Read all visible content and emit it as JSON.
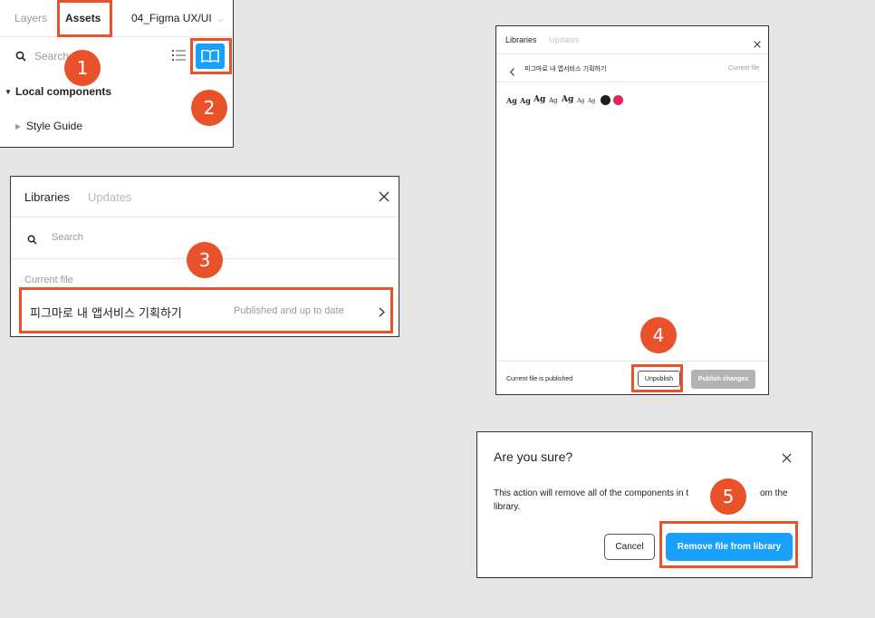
{
  "assets_panel": {
    "tab_layers": "Layers",
    "tab_assets": "Assets",
    "file_name": "04_Figma UX/UI",
    "search_placeholder": "Search",
    "local_components": "Local components",
    "style_guide": "Style Guide"
  },
  "libraries_panel": {
    "tab_libraries": "Libraries",
    "tab_updates": "Updates",
    "search_placeholder": "Search",
    "section_label": "Current file",
    "file_name": "피그마로 내 앱서비스 기획하기",
    "file_status": "Published and up to date"
  },
  "file_detail_panel": {
    "tab_libraries": "Libraries",
    "tab_updates": "Updates",
    "file_name": "피그마로 내 앱서비스 기획하기",
    "current_file": "Current file",
    "text_styles": [
      "Ag",
      "Ag",
      "Ag",
      "Ag",
      "Ag",
      "Ag",
      "Ag"
    ],
    "color_styles": [
      "#1e1e1e",
      "#e8245c"
    ],
    "footer_status": "Current file is published",
    "unpublish": "Unpublish",
    "publish_changes": "Publish changes"
  },
  "confirm_dialog": {
    "title": "Are you sure?",
    "message_part1": "This action will remove all of the components in t",
    "message_part2": "om the",
    "message_line2": "library.",
    "cancel": "Cancel",
    "remove": "Remove file from library"
  },
  "badges": [
    "1",
    "2",
    "3",
    "4",
    "5"
  ],
  "colors": {
    "highlight": "#e8512a",
    "accent_blue": "#18a0fb",
    "disabled_gray": "#b3b3b3"
  }
}
